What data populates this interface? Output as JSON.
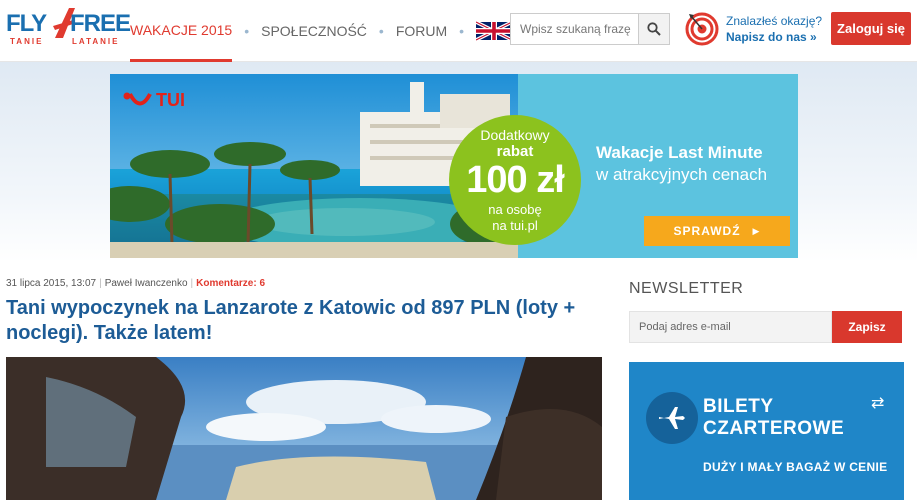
{
  "logo": {
    "word1": "FLY",
    "word2": "FREE",
    "sub1": "TANIE",
    "sub2": "LATANIE"
  },
  "nav": {
    "items": [
      {
        "label": "WAKACJE 2015",
        "active": true
      },
      {
        "label": "SPOŁECZNOŚĆ",
        "active": false
      },
      {
        "label": "FORUM",
        "active": false
      }
    ],
    "language_flag": "uk-flag-icon"
  },
  "search": {
    "placeholder": "Wpisz szukaną frazę",
    "icon": "search-icon"
  },
  "deal": {
    "question": "Znalazłeś okazję?",
    "link": "Napisz do nas »"
  },
  "header": {
    "login_label": "Zaloguj się"
  },
  "banner": {
    "brand": "TUI",
    "bubble": {
      "line1": "Dodatkowy",
      "line2": "rabat",
      "amount": "100 zł",
      "line4": "na osobę",
      "line5": "na tui.pl"
    },
    "promo_title": "Wakacje Last Minute",
    "promo_subtitle": "w atrakcyjnych cenach",
    "cta": "SPRAWDŹ",
    "colors": {
      "panel": "#5cc3df",
      "bubble": "#8cc21e",
      "cta": "#f6a81c"
    }
  },
  "article": {
    "date": "31 lipca 2015, 13:07",
    "author": "Paweł Iwanczenko",
    "comments": "Komentarze: 6",
    "title": "Tani wypoczynek na Lanzarote z Katowic od 897 PLN (loty + noclegi). Także latem!"
  },
  "newsletter": {
    "title": "NEWSLETTER",
    "placeholder": "Podaj adres e-mail",
    "button": "Zapisz"
  },
  "charter": {
    "line1": "BILETY",
    "line2": "CZARTEROWE",
    "subtitle": "DUŻY I MAŁY BAGAŻ W CENIE",
    "icon": "airplane-icon",
    "color": "#1f86c8"
  },
  "colors": {
    "brand_blue": "#1a6fb0",
    "accent_red": "#d9382d",
    "title_blue": "#1d5c96"
  }
}
